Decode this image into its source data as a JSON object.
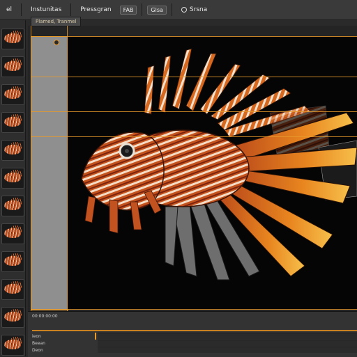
{
  "menubar": {
    "items": [
      {
        "label": "el",
        "style": "plain"
      },
      {
        "label": "Instunitas",
        "style": "plain"
      },
      {
        "label": "Pressgran",
        "style": "plain"
      },
      {
        "label": "FAB",
        "style": "box"
      },
      {
        "label": "Glsa",
        "style": "box"
      },
      {
        "label": "Srsna",
        "style": "plain"
      }
    ]
  },
  "document": {
    "tab_label": "Plamed, Tranmel"
  },
  "timeline": {
    "top_label": "00:00:00:00",
    "rows": [
      {
        "label": "ieon"
      },
      {
        "label": "Beean"
      },
      {
        "label": "Deon"
      }
    ]
  },
  "canvas": {
    "subject": "lionfish-image"
  },
  "colors": {
    "guide": "#e89a2c",
    "panel": "#3a3a3a",
    "canvas_bg": "#050505"
  }
}
